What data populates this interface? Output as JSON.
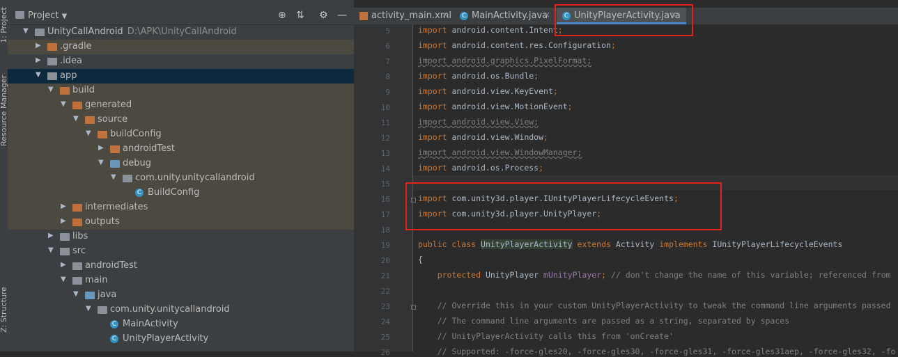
{
  "left_strip": {
    "project_tab": "1: Project",
    "resource_tab": "Resource Manager",
    "structure_tab": "Z: Structure"
  },
  "project_panel": {
    "title": "Project",
    "tree": [
      {
        "label": "UnityCallAndroid",
        "path": "D:\\APK\\UnityCallAndroid",
        "depth": 0,
        "arrow": "▼",
        "icon": "gray"
      },
      {
        "label": ".gradle",
        "depth": 1,
        "arrow": "▶",
        "icon": "orange",
        "bg": "build"
      },
      {
        "label": ".idea",
        "depth": 1,
        "arrow": "▶",
        "icon": "gray"
      },
      {
        "label": "app",
        "depth": 1,
        "arrow": "▼",
        "icon": "gray",
        "bg": "sel"
      },
      {
        "label": "build",
        "depth": 2,
        "arrow": "▼",
        "icon": "orange",
        "bg": "build"
      },
      {
        "label": "generated",
        "depth": 3,
        "arrow": "▼",
        "icon": "orange",
        "bg": "build"
      },
      {
        "label": "source",
        "depth": 4,
        "arrow": "▼",
        "icon": "orange",
        "bg": "build"
      },
      {
        "label": "buildConfig",
        "depth": 5,
        "arrow": "▼",
        "icon": "orange",
        "bg": "build"
      },
      {
        "label": "androidTest",
        "depth": 6,
        "arrow": "▶",
        "icon": "orange",
        "bg": "build"
      },
      {
        "label": "debug",
        "depth": 6,
        "arrow": "▼",
        "icon": "blue",
        "bg": "build"
      },
      {
        "label": "com.unity.unitycallandroid",
        "depth": 7,
        "arrow": "▼",
        "icon": "gray",
        "bg": "build"
      },
      {
        "label": "BuildConfig",
        "depth": 8,
        "arrow": "",
        "icon": "class",
        "bg": "build"
      },
      {
        "label": "intermediates",
        "depth": 3,
        "arrow": "▶",
        "icon": "orange",
        "bg": "build"
      },
      {
        "label": "outputs",
        "depth": 3,
        "arrow": "▶",
        "icon": "orange",
        "bg": "build"
      },
      {
        "label": "libs",
        "depth": 2,
        "arrow": "▶",
        "icon": "gray"
      },
      {
        "label": "src",
        "depth": 2,
        "arrow": "▼",
        "icon": "gray"
      },
      {
        "label": "androidTest",
        "depth": 3,
        "arrow": "▶",
        "icon": "gray"
      },
      {
        "label": "main",
        "depth": 3,
        "arrow": "▼",
        "icon": "gray"
      },
      {
        "label": "java",
        "depth": 4,
        "arrow": "▼",
        "icon": "blue"
      },
      {
        "label": "com.unity.unitycallandroid",
        "depth": 5,
        "arrow": "▼",
        "icon": "gray"
      },
      {
        "label": "MainActivity",
        "depth": 6,
        "arrow": "",
        "icon": "class"
      },
      {
        "label": "UnityPlayerActivity",
        "depth": 6,
        "arrow": "",
        "icon": "class"
      }
    ]
  },
  "editor": {
    "tabs": [
      {
        "label": "activity_main.xml",
        "icon": "xml",
        "active": false
      },
      {
        "label": "MainActivity.java",
        "icon": "class",
        "active": false
      },
      {
        "label": "UnityPlayerActivity.java",
        "icon": "class",
        "active": true
      }
    ],
    "lines": [
      {
        "n": "5",
        "t": "import android.content.Intent;",
        "s": "imp"
      },
      {
        "n": "6",
        "t": "import android.content.res.Configuration;",
        "s": "imp"
      },
      {
        "n": "7",
        "t": "import android.graphics.PixelFormat;",
        "s": "unused"
      },
      {
        "n": "8",
        "t": "import android.os.Bundle;",
        "s": "imp"
      },
      {
        "n": "9",
        "t": "import android.view.KeyEvent;",
        "s": "imp"
      },
      {
        "n": "10",
        "t": "import android.view.MotionEvent;",
        "s": "imp"
      },
      {
        "n": "11",
        "t": "import android.view.View;",
        "s": "unused"
      },
      {
        "n": "12",
        "t": "import android.view.Window;",
        "s": "imp"
      },
      {
        "n": "13",
        "t": "import android.view.WindowManager;",
        "s": "unused"
      },
      {
        "n": "14",
        "t": "import android.os.Process;",
        "s": "imp"
      },
      {
        "n": "15",
        "t": "",
        "s": "blank"
      },
      {
        "n": "16",
        "t": "import com.unity3d.player.IUnityPlayerLifecycleEvents;",
        "s": "imp"
      },
      {
        "n": "17",
        "t": "import com.unity3d.player.UnityPlayer;",
        "s": "imp"
      },
      {
        "n": "18",
        "t": "",
        "s": "blank"
      },
      {
        "n": "19",
        "t": "public class UnityPlayerActivity extends Activity implements IUnityPlayerLifecycleEvents",
        "s": "class"
      },
      {
        "n": "20",
        "t": "{",
        "s": "plain"
      },
      {
        "n": "21",
        "t": "    protected UnityPlayer mUnityPlayer; // don't change the name of this variable; referenced from",
        "s": "field"
      },
      {
        "n": "22",
        "t": "",
        "s": "blank"
      },
      {
        "n": "23",
        "t": "    // Override this in your custom UnityPlayerActivity to tweak the command line arguments passed",
        "s": "cmt"
      },
      {
        "n": "24",
        "t": "    // The command line arguments are passed as a string, separated by spaces",
        "s": "cmt"
      },
      {
        "n": "25",
        "t": "    // UnityPlayerActivity calls this from 'onCreate'",
        "s": "cmt"
      },
      {
        "n": "26",
        "t": "    // Supported: -force-gles20, -force-gles30, -force-gles31, -force-gles31aep, -force-gles32, -fo",
        "s": "cmt"
      }
    ]
  },
  "colors": {
    "highlight_box": "#e0241b",
    "selection": "#0d293e",
    "build_bg": "#4c4941",
    "tab_underline": "#4a88c7"
  }
}
